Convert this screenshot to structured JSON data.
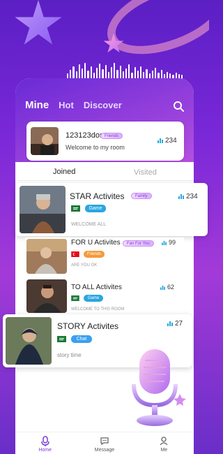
{
  "colors": {
    "accent": "#7a3ad6",
    "live_blue": "#2aa6e0",
    "chat_blue": "#3aa0f0",
    "friends_orange": "#f59a3a"
  },
  "nav": {
    "tabs": [
      "Mine",
      "Hot",
      "Discover"
    ],
    "active": "Mine",
    "search_icon": "search-icon"
  },
  "my_room": {
    "name": "123123doso",
    "badge": "Friends",
    "greeting": "Welcome to my room",
    "count": "234"
  },
  "subtabs": {
    "joined": "Joined",
    "visited": "Visited",
    "active": "Joined"
  },
  "rooms": [
    {
      "title": "STAR Activites",
      "badge": "Family",
      "count": "234",
      "flag": "Saudi Arabia",
      "tag": "Game",
      "tag_color": "#2aa6e0",
      "desc": "WELCOME ALL"
    },
    {
      "title": "FOR U  Activites",
      "badge": "Fan For You",
      "count": "99",
      "flag": "Turkey",
      "tag": "Friends",
      "tag_color": "#f59a3a",
      "desc": "ARE YOU OK"
    },
    {
      "title": "TO ALL Activites",
      "badge": "",
      "count": "62",
      "flag": "Saudi Arabia",
      "tag": "Game",
      "tag_color": "#2aa6e0",
      "desc": "WELCOME TO THIS ROOM"
    },
    {
      "title": "STORY Activites",
      "badge": "",
      "count": "27",
      "flag": "Saudi Arabia",
      "tag": "Chat",
      "tag_color": "#3aa0f0",
      "desc": "story time"
    }
  ],
  "tabbar": [
    {
      "label": "Home",
      "icon": "home-mic-icon",
      "active": true
    },
    {
      "label": "Message",
      "icon": "message-icon",
      "active": false
    },
    {
      "label": "Me",
      "icon": "profile-icon",
      "active": false
    }
  ]
}
